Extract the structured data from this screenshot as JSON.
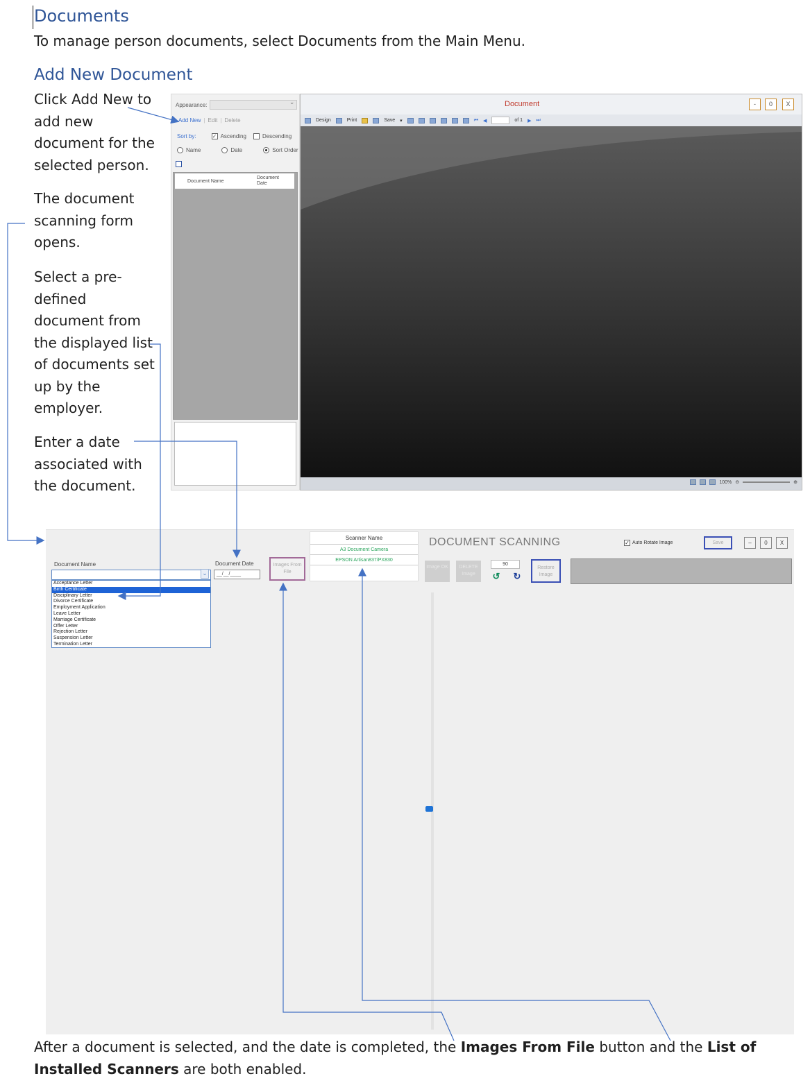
{
  "heading": "Documents",
  "intro": "To manage person documents, select Documents from the Main Menu.",
  "subheading": "Add New Document",
  "steps": {
    "click_add_new": "Click Add New to add new document for the selected person.",
    "form_opens": "The document scanning form opens.",
    "select_document": "Select a pre-defined document from the displayed list of documents set up by the employer.",
    "enter_date": "Enter a date associated with the document."
  },
  "footer": {
    "part1": "After a document is selected, and the date is completed, the ",
    "bold1": "Images From File",
    "part2": " button and the ",
    "bold2": "List of Installed Scanners",
    "part3": " are both enabled."
  },
  "list_panel": {
    "appearance_label": "Appearance:",
    "add_new": "Add New",
    "edit": "Edit",
    "delete": "Delete",
    "sort_by": "Sort by:",
    "ascending": "Ascending",
    "descending": "Descending",
    "sort_name": "Name",
    "sort_date": "Date",
    "sort_order": "Sort Order",
    "col_document_name": "Document Name",
    "col_document_date": "Document Date"
  },
  "viewer": {
    "title": "Document",
    "min_label": "-",
    "max_label": "0",
    "close_label": "X",
    "design": "Design",
    "print": "Print",
    "save": "Save",
    "page_of": "of 1",
    "zoom": "100%"
  },
  "scan_form": {
    "document_name_label": "Document Name",
    "document_date_label": "Document Date",
    "date_placeholder": "__/__/____",
    "images_from_file": "Images From File",
    "scanner_name_header": "Scanner Name",
    "scanners": [
      "A3 Document Camera",
      "EPSON Artisan837/PX830"
    ],
    "title": "DOCUMENT SCANNING",
    "auto_rotate": "Auto Rotate Image",
    "save": "Save",
    "min_label": "–",
    "max_label": "0",
    "close_label": "X",
    "image_ok": "Image OK",
    "delete_image": "DELETE Image",
    "rotate_value": "90",
    "restore_image": "Restore Image",
    "document_options": [
      "Acceptance Letter",
      "Birth Certificate",
      "Disciplinary Letter",
      "Divorce Certificate",
      "Employment Application",
      "Leave Letter",
      "Marriage Certificate",
      "Offer Letter",
      "Rejection Letter",
      "Suspension Letter",
      "Termination Letter"
    ],
    "selected_index": 1
  },
  "colors": {
    "heading": "#2f5597",
    "arrow": "#4472c4",
    "selection": "#1e63d6",
    "scanner_text": "#2aa55c"
  }
}
